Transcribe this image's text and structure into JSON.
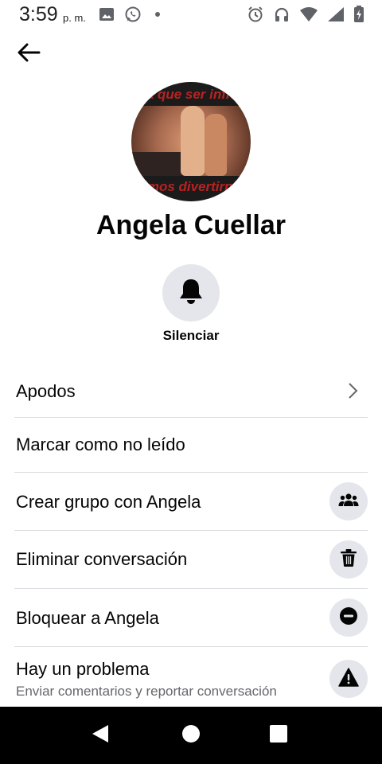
{
  "status_bar": {
    "time": "3:59",
    "ampm": "p. m.",
    "left_icons": [
      "image-icon",
      "whatsapp-icon",
      "dot-icon"
    ],
    "right_icons": [
      "alarm-icon",
      "headphones-icon",
      "wifi-icon",
      "signal-icon",
      "battery-icon"
    ]
  },
  "header": {
    "back_icon": "arrow-left-icon"
  },
  "profile": {
    "name": "Angela Cuellar",
    "avatar_text_top": "ra que ser infiel",
    "avatar_text_bottom": "demos divertirnos ju"
  },
  "actions": {
    "mute_label": "Silenciar",
    "mute_icon": "bell-icon"
  },
  "menu": [
    {
      "label": "Apodos",
      "icon": "chevron-right-icon"
    },
    {
      "label": "Marcar como no leído"
    },
    {
      "label": "Crear grupo con Angela",
      "icon": "group-icon"
    },
    {
      "label": "Eliminar conversación",
      "icon": "trash-icon"
    },
    {
      "label": "Bloquear a Angela",
      "icon": "block-icon"
    },
    {
      "label": "Hay un problema",
      "sublabel": "Enviar comentarios y reportar conversación",
      "icon": "warning-icon"
    }
  ],
  "nav_bar": {
    "buttons": [
      "back-triangle-icon",
      "home-circle-icon",
      "recents-square-icon"
    ]
  },
  "colors": {
    "background": "#ffffff",
    "text": "#050505",
    "secondary_text": "#65676b",
    "button_bg": "#e4e6eb",
    "divider": "#dadde1",
    "nav_bg": "#000000"
  }
}
